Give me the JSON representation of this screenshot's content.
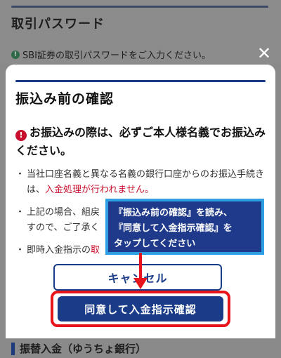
{
  "background": {
    "title": "取引パスワード",
    "notice": "SBI証券の取引パスワードをご入力ください。",
    "notice_icon": "info-icon",
    "close_icon": "close-icon",
    "close_glyph": "✕",
    "bottom_title": "振替入金（ゆうちょ銀行）"
  },
  "modal": {
    "title": "振込み前の確認",
    "warning_icon": "exclamation-icon",
    "warning_glyph": "!",
    "warning_text": "お振込みの際は、必ずご本人様名義でお振込みください。",
    "bullet1_text": "当社口座名義と異なる名義の銀行口座からのお振込手続きは、",
    "bullet1_red": "入金処理が行われません。",
    "bullet2_text": "上記の場合、組戻",
    "bullet2_text2": "すので、ご了承く",
    "bullet3_text": "即時入金指示の",
    "bullet3_red": "取",
    "cancel_label": "キャンセル",
    "agree_label": "同意して入金指示確認"
  },
  "callout": {
    "line1": "『振込み前の確認』を読み、",
    "line2": "『同意して入金指示確認』を",
    "line3": "タップしてください"
  },
  "colors": {
    "brand_navy": "#1a3c88",
    "warning_red": "#c8102e",
    "highlight_red": "#e8141c",
    "callout_border": "#2f9fe4"
  }
}
